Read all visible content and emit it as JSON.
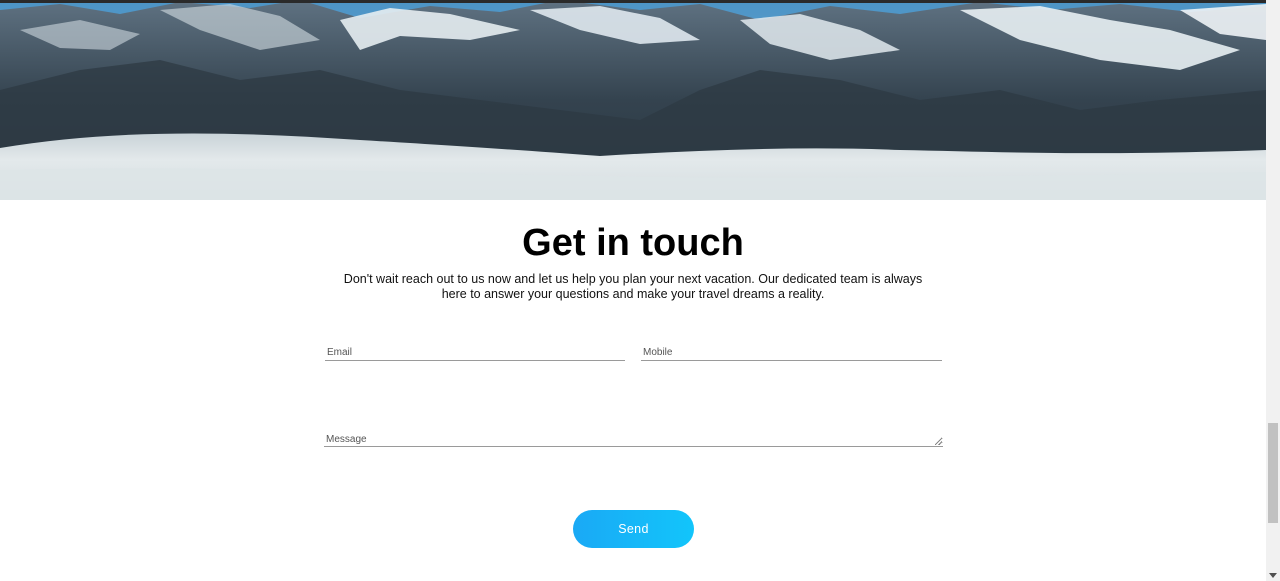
{
  "contact": {
    "title": "Get in touch",
    "description": "Don't wait reach out to us now and let us help you plan your next vacation. Our dedicated team is always here to answer your questions and make your travel dreams a reality."
  },
  "form": {
    "email_placeholder": "Email",
    "mobile_placeholder": "Mobile",
    "message_placeholder": "Message",
    "send_label": "Send"
  },
  "colors": {
    "accent": "#12b6f8",
    "text": "#000000"
  },
  "scrollbar": {
    "position_fraction": 0.78
  }
}
